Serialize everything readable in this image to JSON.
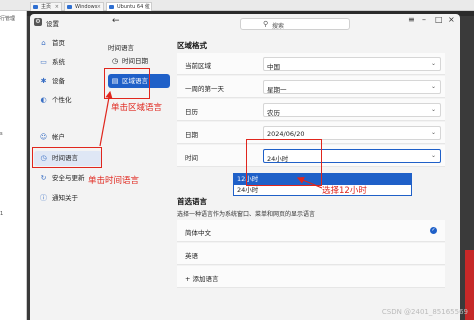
{
  "host": {
    "tabs": [
      {
        "label": "主页"
      },
      {
        "label": "Windows"
      },
      {
        "label": "Ubuntu 64 位"
      }
    ],
    "left_panel": [
      "行管理",
      "s",
      "1"
    ]
  },
  "app": {
    "title": "设置",
    "search_placeholder": "搜索"
  },
  "nav": {
    "items": [
      {
        "label": "首页"
      },
      {
        "label": "系统"
      },
      {
        "label": "设备"
      },
      {
        "label": "个性化"
      },
      {
        "label": "帐户"
      },
      {
        "label": "时间语言"
      },
      {
        "label": "安全与更新"
      },
      {
        "label": "通知关于"
      }
    ]
  },
  "sub": {
    "heading": "时间语言",
    "items": [
      {
        "label": "时间日期"
      },
      {
        "label": "区域语言"
      }
    ]
  },
  "region": {
    "title": "区域格式",
    "rows": [
      {
        "label": "当前区域",
        "value": "中国"
      },
      {
        "label": "一周的第一天",
        "value": "星期一"
      },
      {
        "label": "日历",
        "value": "农历"
      },
      {
        "label": "日期",
        "value": "2024/06/20"
      },
      {
        "label": "时间",
        "value": "24小时"
      }
    ],
    "time_options": [
      "12小时",
      "24小时"
    ]
  },
  "language": {
    "title": "首选语言",
    "hint": "选择一种语言作为系统窗口、菜单和网页的显示语言",
    "items": [
      "简体中文",
      "英语"
    ],
    "add": "添加语言"
  },
  "annotations": {
    "click_region": "单击区域语言",
    "click_time": "单击时间语言",
    "choose_12": "选择12小时",
    "color": "#e0261d"
  },
  "watermark": "CSDN @2401_85165569"
}
